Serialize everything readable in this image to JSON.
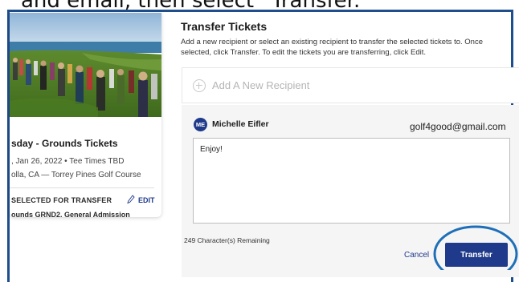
{
  "caption": {
    "text": "and email, then select “Transfer.”"
  },
  "event_card": {
    "title": "sday - Grounds Tickets",
    "date": ", Jan 26, 2022 • Tee Times TBD",
    "venue": "olla, CA — Torrey Pines Golf Course",
    "selected_label": "SELECTED FOR TRANSFER",
    "edit_label": "EDIT",
    "ticket_desc": "ounds GRND2, General Admission"
  },
  "transfer": {
    "title": "Transfer Tickets",
    "description": "Add a new recipient or select an existing recipient to transfer the selected tickets to. Once selected, click Transfer. To edit the tickets you are transferring, click Edit.",
    "add_recipient_label": "Add A New Recipient",
    "recipient": {
      "initials": "ME",
      "name": "Michelle Eifler",
      "email": "golf4good@gmail.com"
    },
    "message": "Enjoy!",
    "chars_remaining": "249 Character(s) Remaining",
    "cancel_label": "Cancel",
    "transfer_label": "Transfer"
  },
  "colors": {
    "accent": "#1f3a8a",
    "frame": "#1f4e8c",
    "annotation_ring": "#1f6fb8"
  },
  "icons": [
    "plus-circle-icon",
    "pencil-icon"
  ]
}
